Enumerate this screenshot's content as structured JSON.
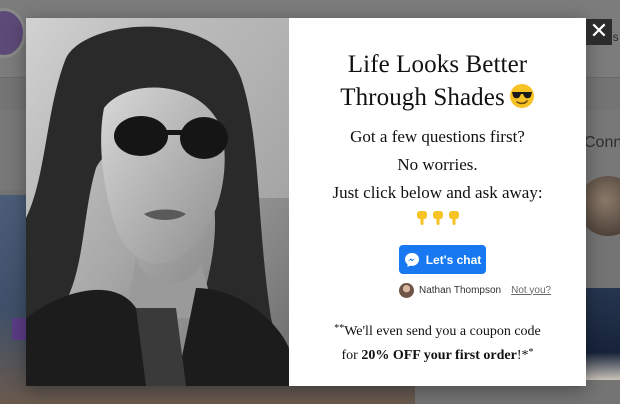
{
  "background": {
    "header_fragment": "es",
    "right_heading_fragment": "Conn",
    "caption_fragment": "\" •  •  •"
  },
  "modal": {
    "close_label": "✕",
    "headline_line1": "Life Looks Better",
    "headline_line2": "Through Shades",
    "headline_emoji": "sunglasses-emoji-icon",
    "body_line1": "Got a few questions first?",
    "body_line2": "No worries.",
    "body_line3": "Just click below and ask away:",
    "pointer_emoji": "pointing-down-emoji-icon",
    "chat_button_label": "Let's chat",
    "user_name": "Nathan Thompson",
    "not_you_label": "Not you?",
    "coupon_prefix_mark": "**",
    "coupon_line1": "We'll even send you a coupon code",
    "coupon_line2_prefix": "for ",
    "coupon_line2_bold": "20% OFF your first order",
    "coupon_line2_suffix": "!*",
    "coupon_suffix_mark": "*"
  },
  "colors": {
    "messenger_blue": "#1778f2",
    "overlay": "#747474",
    "close_bg": "#2b2b2b"
  }
}
